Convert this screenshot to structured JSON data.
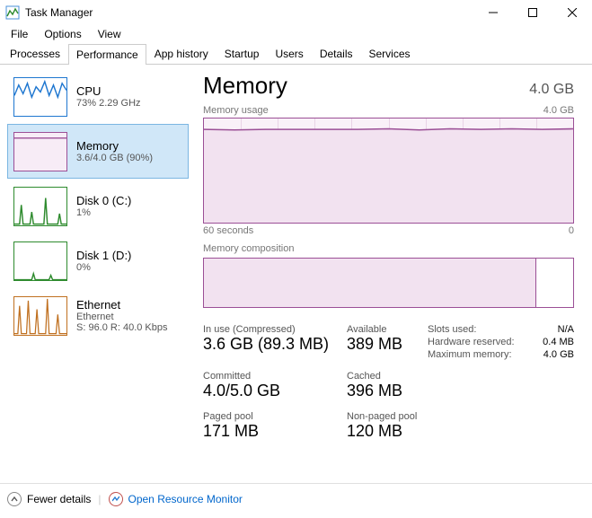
{
  "window": {
    "title": "Task Manager"
  },
  "menu": {
    "file": "File",
    "options": "Options",
    "view": "View"
  },
  "tabs": {
    "processes": "Processes",
    "performance": "Performance",
    "app_history": "App history",
    "startup": "Startup",
    "users": "Users",
    "details": "Details",
    "services": "Services"
  },
  "sidebar": {
    "cpu": {
      "name": "CPU",
      "stat": "73%  2.29 GHz",
      "color": "#1f77d0"
    },
    "memory": {
      "name": "Memory",
      "stat": "3.6/4.0 GB (90%)",
      "color": "#9b4f96"
    },
    "disk0": {
      "name": "Disk 0 (C:)",
      "stat": "1%",
      "color": "#2e8b2e"
    },
    "disk1": {
      "name": "Disk 1 (D:)",
      "stat": "0%",
      "color": "#2e8b2e"
    },
    "ethernet": {
      "name": "Ethernet",
      "sub": "Ethernet",
      "stat": "S: 96.0  R: 40.0 Kbps",
      "color": "#c07020"
    }
  },
  "main": {
    "title": "Memory",
    "total": "4.0 GB",
    "usage_label": "Memory usage",
    "usage_max": "4.0 GB",
    "axis_left": "60 seconds",
    "axis_right": "0",
    "comp_label": "Memory composition",
    "comp_used_pct": 90,
    "stats": {
      "inuse_label": "In use (Compressed)",
      "inuse_value": "3.6 GB (89.3 MB)",
      "avail_label": "Available",
      "avail_value": "389 MB",
      "committed_label": "Committed",
      "committed_value": "4.0/5.0 GB",
      "cached_label": "Cached",
      "cached_value": "396 MB",
      "paged_label": "Paged pool",
      "paged_value": "171 MB",
      "nonpaged_label": "Non-paged pool",
      "nonpaged_value": "120 MB",
      "slots_label": "Slots used:",
      "slots_value": "N/A",
      "hwres_label": "Hardware reserved:",
      "hwres_value": "0.4 MB",
      "maxmem_label": "Maximum memory:",
      "maxmem_value": "4.0 GB"
    }
  },
  "footer": {
    "fewer": "Fewer details",
    "orm": "Open Resource Monitor"
  },
  "chart_data": {
    "type": "line",
    "title": "Memory usage",
    "xlabel": "60 seconds",
    "ylabel": "",
    "ylim": [
      0,
      4.0
    ],
    "yunit": "GB",
    "x": [
      60,
      55,
      50,
      45,
      40,
      35,
      30,
      25,
      20,
      15,
      10,
      5,
      0
    ],
    "values": [
      3.6,
      3.58,
      3.6,
      3.6,
      3.6,
      3.6,
      3.62,
      3.58,
      3.62,
      3.6,
      3.62,
      3.6,
      3.62
    ],
    "composition": {
      "in_use_gb": 3.6,
      "total_gb": 4.0
    }
  }
}
